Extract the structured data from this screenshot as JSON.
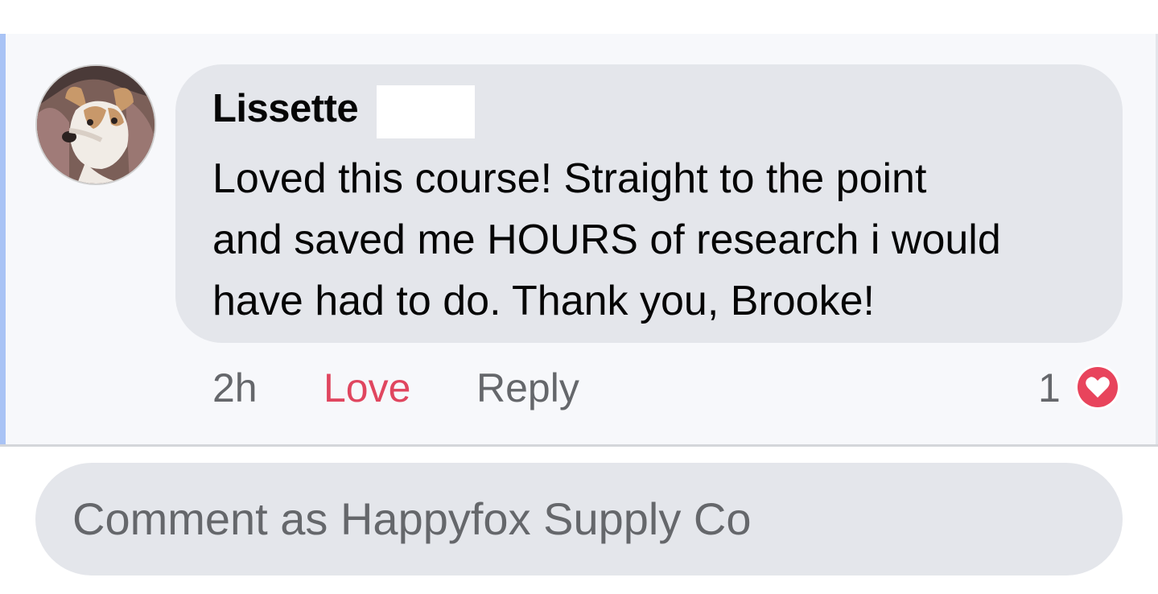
{
  "comment": {
    "author": "Lissette",
    "text_lines": [
      "Loved this course! Straight to the point",
      "and saved me HOURS of research i would",
      "have had to do. Thank you, Brooke!"
    ],
    "time": "2h",
    "love_label": "Love",
    "reply_label": "Reply",
    "reaction_count": "1",
    "reaction_icon": "heart-icon"
  },
  "composer": {
    "placeholder": "Comment as Happyfox Supply Co"
  },
  "colors": {
    "love_accent": "#e0465f",
    "bubble_bg": "#e4e6eb",
    "highlight_bar": "#a9c3f5",
    "muted_text": "#65676b"
  }
}
